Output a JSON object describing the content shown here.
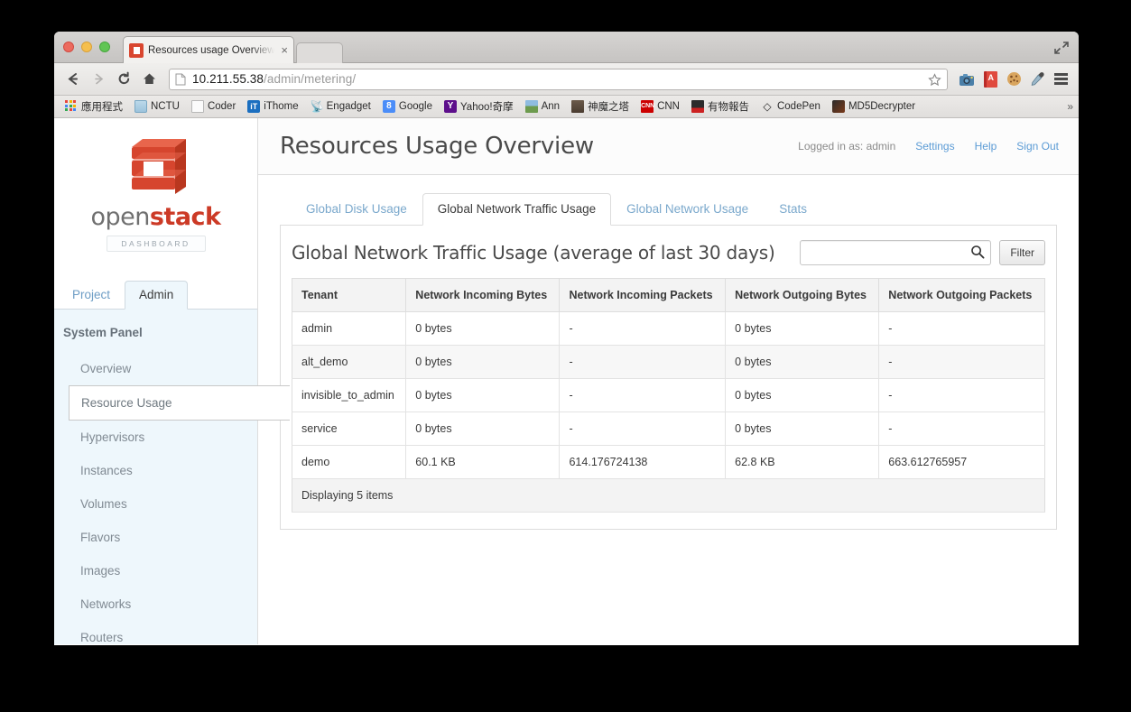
{
  "browser": {
    "tab_title": "Resources usage Overview",
    "tab_close": "×",
    "back_icon": "←",
    "forward_icon": "→",
    "reload_icon": "⟳",
    "home_icon": "home-icon",
    "url_host": "10.211.55.38",
    "url_path": "/admin/metering/",
    "star_icon": "star-icon",
    "extensions": [
      {
        "name": "camera-extension-icon",
        "glyph": "📷"
      },
      {
        "name": "dictionary-extension-icon",
        "glyph": ""
      },
      {
        "name": "cookie-extension-icon",
        "glyph": "🍪"
      },
      {
        "name": "eyedropper-extension-icon",
        "glyph": "🖉"
      },
      {
        "name": "chrome-menu-icon",
        "glyph": ""
      }
    ],
    "bookmarks": [
      {
        "label": "應用程式",
        "icon": "apps-grid-icon"
      },
      {
        "label": "NCTU",
        "icon": "folder-icon"
      },
      {
        "label": "Coder",
        "icon": "document-icon"
      },
      {
        "label": "iThome",
        "icon": "ithome-icon"
      },
      {
        "label": "Engadget",
        "icon": "rss-icon"
      },
      {
        "label": "Google",
        "icon": "google-icon"
      },
      {
        "label": "Yahoo!奇摩",
        "icon": "yahoo-icon"
      },
      {
        "label": "Ann",
        "icon": "photo-icon"
      },
      {
        "label": "神魔之塔",
        "icon": "tower-icon"
      },
      {
        "label": "CNN",
        "icon": "cnn-icon"
      },
      {
        "label": "有物報告",
        "icon": "report-icon"
      },
      {
        "label": "CodePen",
        "icon": "codepen-icon"
      },
      {
        "label": "MD5Decrypter",
        "icon": "md5-icon"
      }
    ],
    "bookmarks_overflow": "»"
  },
  "sidebar": {
    "logo_word_1": "open",
    "logo_word_2": "stack",
    "logo_badge": "DASHBOARD",
    "tabs": [
      {
        "label": "Project",
        "active": false
      },
      {
        "label": "Admin",
        "active": true
      }
    ],
    "panel_heading": "System Panel",
    "items": [
      {
        "label": "Overview",
        "active": false
      },
      {
        "label": "Resource Usage",
        "active": true
      },
      {
        "label": "Hypervisors",
        "active": false
      },
      {
        "label": "Instances",
        "active": false
      },
      {
        "label": "Volumes",
        "active": false
      },
      {
        "label": "Flavors",
        "active": false
      },
      {
        "label": "Images",
        "active": false
      },
      {
        "label": "Networks",
        "active": false
      },
      {
        "label": "Routers",
        "active": false
      }
    ]
  },
  "header": {
    "title": "Resources Usage Overview",
    "logged_in_as": "Logged in as: admin",
    "links": [
      {
        "label": "Settings"
      },
      {
        "label": "Help"
      },
      {
        "label": "Sign Out"
      }
    ]
  },
  "tabs": [
    {
      "label": "Global Disk Usage",
      "active": false
    },
    {
      "label": "Global Network Traffic Usage",
      "active": true
    },
    {
      "label": "Global Network Usage",
      "active": false
    },
    {
      "label": "Stats",
      "active": false
    }
  ],
  "panel": {
    "title": "Global Network Traffic Usage (average of last 30 days)",
    "search_value": "",
    "search_placeholder": "",
    "search_icon": "search-icon",
    "filter_label": "Filter",
    "table": {
      "columns": [
        "Tenant",
        "Network Incoming Bytes",
        "Network Incoming Packets",
        "Network Outgoing Bytes",
        "Network Outgoing Packets"
      ],
      "rows": [
        [
          "admin",
          "0 bytes",
          "-",
          "0 bytes",
          "-"
        ],
        [
          "alt_demo",
          "0 bytes",
          "-",
          "0 bytes",
          "-"
        ],
        [
          "invisible_to_admin",
          "0 bytes",
          "-",
          "0 bytes",
          "-"
        ],
        [
          "service",
          "0 bytes",
          "-",
          "0 bytes",
          "-"
        ],
        [
          "demo",
          "60.1 KB",
          "614.176724138",
          "62.8 KB",
          "663.612765957"
        ]
      ],
      "footer": "Displaying 5 items"
    }
  },
  "colors": {
    "accent_red": "#cc3a26",
    "link_blue": "#5b9bd5",
    "sidebar_bg": "#eef7fc"
  }
}
